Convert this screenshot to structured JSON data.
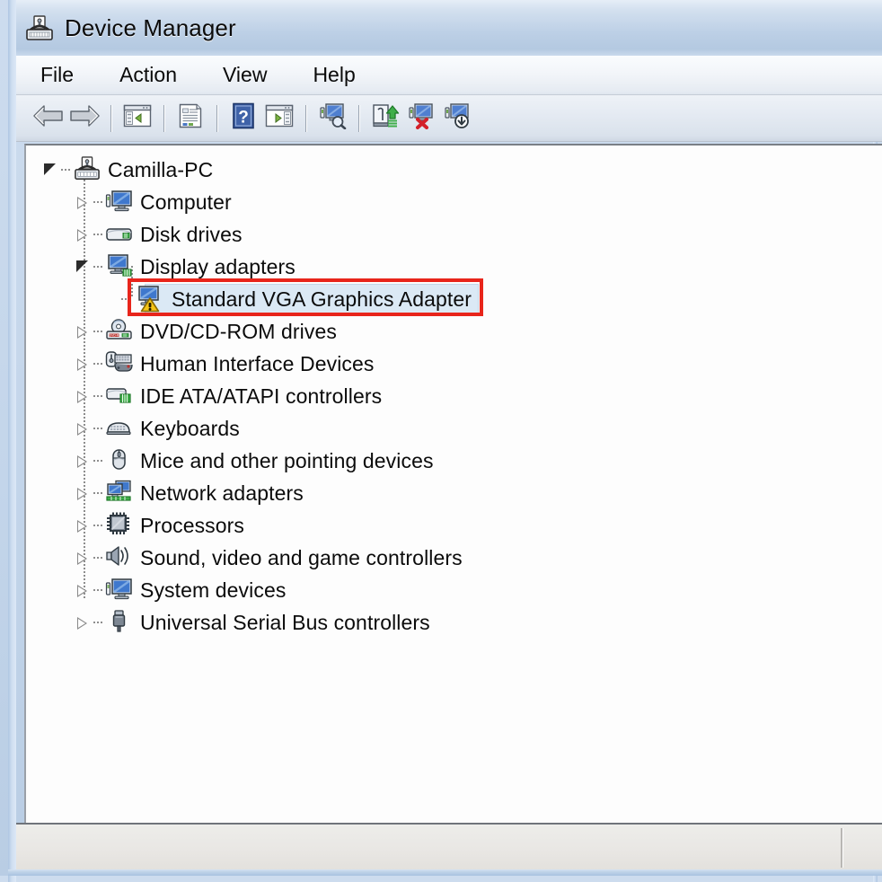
{
  "window": {
    "title": "Device Manager",
    "icon": "device-manager-icon",
    "frame_color": "#b9cde4",
    "titlebar_color": "#bdd0e6"
  },
  "menubar": {
    "items": [
      {
        "label": "File",
        "name": "menu-file"
      },
      {
        "label": "Action",
        "name": "menu-action"
      },
      {
        "label": "View",
        "name": "menu-view"
      },
      {
        "label": "Help",
        "name": "menu-help"
      }
    ]
  },
  "toolbar": {
    "buttons": [
      {
        "icon": "back-arrow-icon",
        "name": "toolbar-back",
        "tooltip": "Back"
      },
      {
        "icon": "forward-arrow-icon",
        "name": "toolbar-forward",
        "tooltip": "Forward"
      },
      {
        "icon": "show-hide-console-tree-icon",
        "name": "toolbar-show-hide-tree",
        "tooltip": "Show/Hide Console Tree"
      },
      {
        "icon": "properties-icon",
        "name": "toolbar-properties",
        "tooltip": "Properties"
      },
      {
        "icon": "help-icon",
        "name": "toolbar-help",
        "tooltip": "Help"
      },
      {
        "icon": "show-hide-action-pane-icon",
        "name": "toolbar-show-hide-action-pane",
        "tooltip": "Show/Hide Action Pane"
      },
      {
        "icon": "scan-for-hardware-changes-icon",
        "name": "toolbar-scan-hardware",
        "tooltip": "Scan for hardware changes"
      },
      {
        "icon": "update-driver-icon",
        "name": "toolbar-update-driver",
        "tooltip": "Update Driver Software"
      },
      {
        "icon": "disable-device-icon",
        "name": "toolbar-disable-device",
        "tooltip": "Disable"
      },
      {
        "icon": "uninstall-device-icon",
        "name": "toolbar-uninstall-device",
        "tooltip": "Uninstall"
      }
    ]
  },
  "tree": {
    "root": {
      "label": "Camilla-PC",
      "icon": "computer-root-icon",
      "expanded": true
    },
    "nodes": [
      {
        "label": "Computer",
        "icon": "computer-icon",
        "expanded": false,
        "depth": 1
      },
      {
        "label": "Disk drives",
        "icon": "disk-drive-icon",
        "expanded": false,
        "depth": 1
      },
      {
        "label": "Display adapters",
        "icon": "display-adapter-icon",
        "expanded": true,
        "depth": 1
      },
      {
        "label": "Standard VGA Graphics Adapter",
        "icon": "display-device-warning-icon",
        "expanded": null,
        "depth": 2,
        "selected": true,
        "warning": true,
        "highlighted": true
      },
      {
        "label": "DVD/CD-ROM drives",
        "icon": "dvd-cdrom-icon",
        "expanded": false,
        "depth": 1
      },
      {
        "label": "Human Interface Devices",
        "icon": "hid-icon",
        "expanded": false,
        "depth": 1
      },
      {
        "label": "IDE ATA/ATAPI controllers",
        "icon": "ide-controller-icon",
        "expanded": false,
        "depth": 1
      },
      {
        "label": "Keyboards",
        "icon": "keyboard-icon",
        "expanded": false,
        "depth": 1
      },
      {
        "label": "Mice and other pointing devices",
        "icon": "mouse-icon",
        "expanded": false,
        "depth": 1
      },
      {
        "label": "Network adapters",
        "icon": "network-adapter-icon",
        "expanded": false,
        "depth": 1
      },
      {
        "label": "Processors",
        "icon": "processor-icon",
        "expanded": false,
        "depth": 1
      },
      {
        "label": "Sound, video and game controllers",
        "icon": "sound-icon",
        "expanded": false,
        "depth": 1
      },
      {
        "label": "System devices",
        "icon": "system-device-icon",
        "expanded": false,
        "depth": 1
      },
      {
        "label": "Universal Serial Bus controllers",
        "icon": "usb-icon",
        "expanded": false,
        "depth": 1
      }
    ]
  },
  "annotation": {
    "type": "red-rectangle-highlight",
    "color": "#e8251b",
    "target": "Standard VGA Graphics Adapter"
  },
  "statusbar": {
    "text": "",
    "right_cell_text": ""
  }
}
